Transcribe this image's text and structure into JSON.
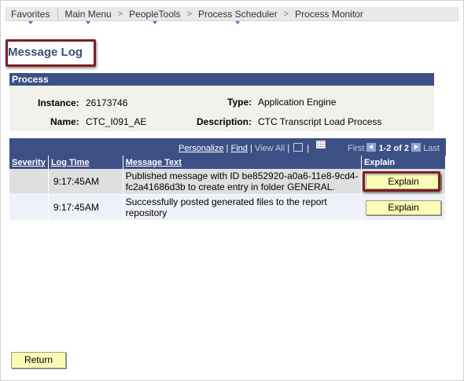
{
  "breadcrumb": {
    "items": [
      {
        "label": "Favorites",
        "dropdown": true
      },
      {
        "label": "Main Menu",
        "dropdown": true
      },
      {
        "label": "PeopleTools",
        "dropdown": true
      },
      {
        "label": "Process Scheduler",
        "dropdown": true
      },
      {
        "label": "Process Monitor",
        "dropdown": false
      }
    ],
    "separator": ">"
  },
  "page_title": "Message Log",
  "process": {
    "header": "Process",
    "instance_label": "Instance:",
    "instance_value": "26173746",
    "type_label": "Type:",
    "type_value": "Application Engine",
    "name_label": "Name:",
    "name_value": "CTC_I091_AE",
    "description_label": "Description:",
    "description_value": "CTC Transcript Load Process"
  },
  "grid": {
    "personalize": "Personalize",
    "find": "Find",
    "view_all": "View All",
    "first": "First",
    "range": "1-2 of 2",
    "last": "Last",
    "columns": [
      "Severity",
      "Log Time",
      "Message Text",
      "Explain"
    ],
    "rows": [
      {
        "severity": "",
        "log_time": "9:17:45AM",
        "message": "Published message with ID be852920-a0a6-11e8-9cd4-fc2a41686d3b to create entry in folder GENERAL.",
        "explain": "Explain"
      },
      {
        "severity": "",
        "log_time": "9:17:45AM",
        "message": "Successfully posted generated files to the report repository",
        "explain": "Explain"
      }
    ]
  },
  "return_label": "Return",
  "colors": {
    "header_blue": "#3d5086",
    "title_blue": "#3a4f7a",
    "button_yellow": "#fbfbb6",
    "highlight_red": "#7a1f24"
  }
}
